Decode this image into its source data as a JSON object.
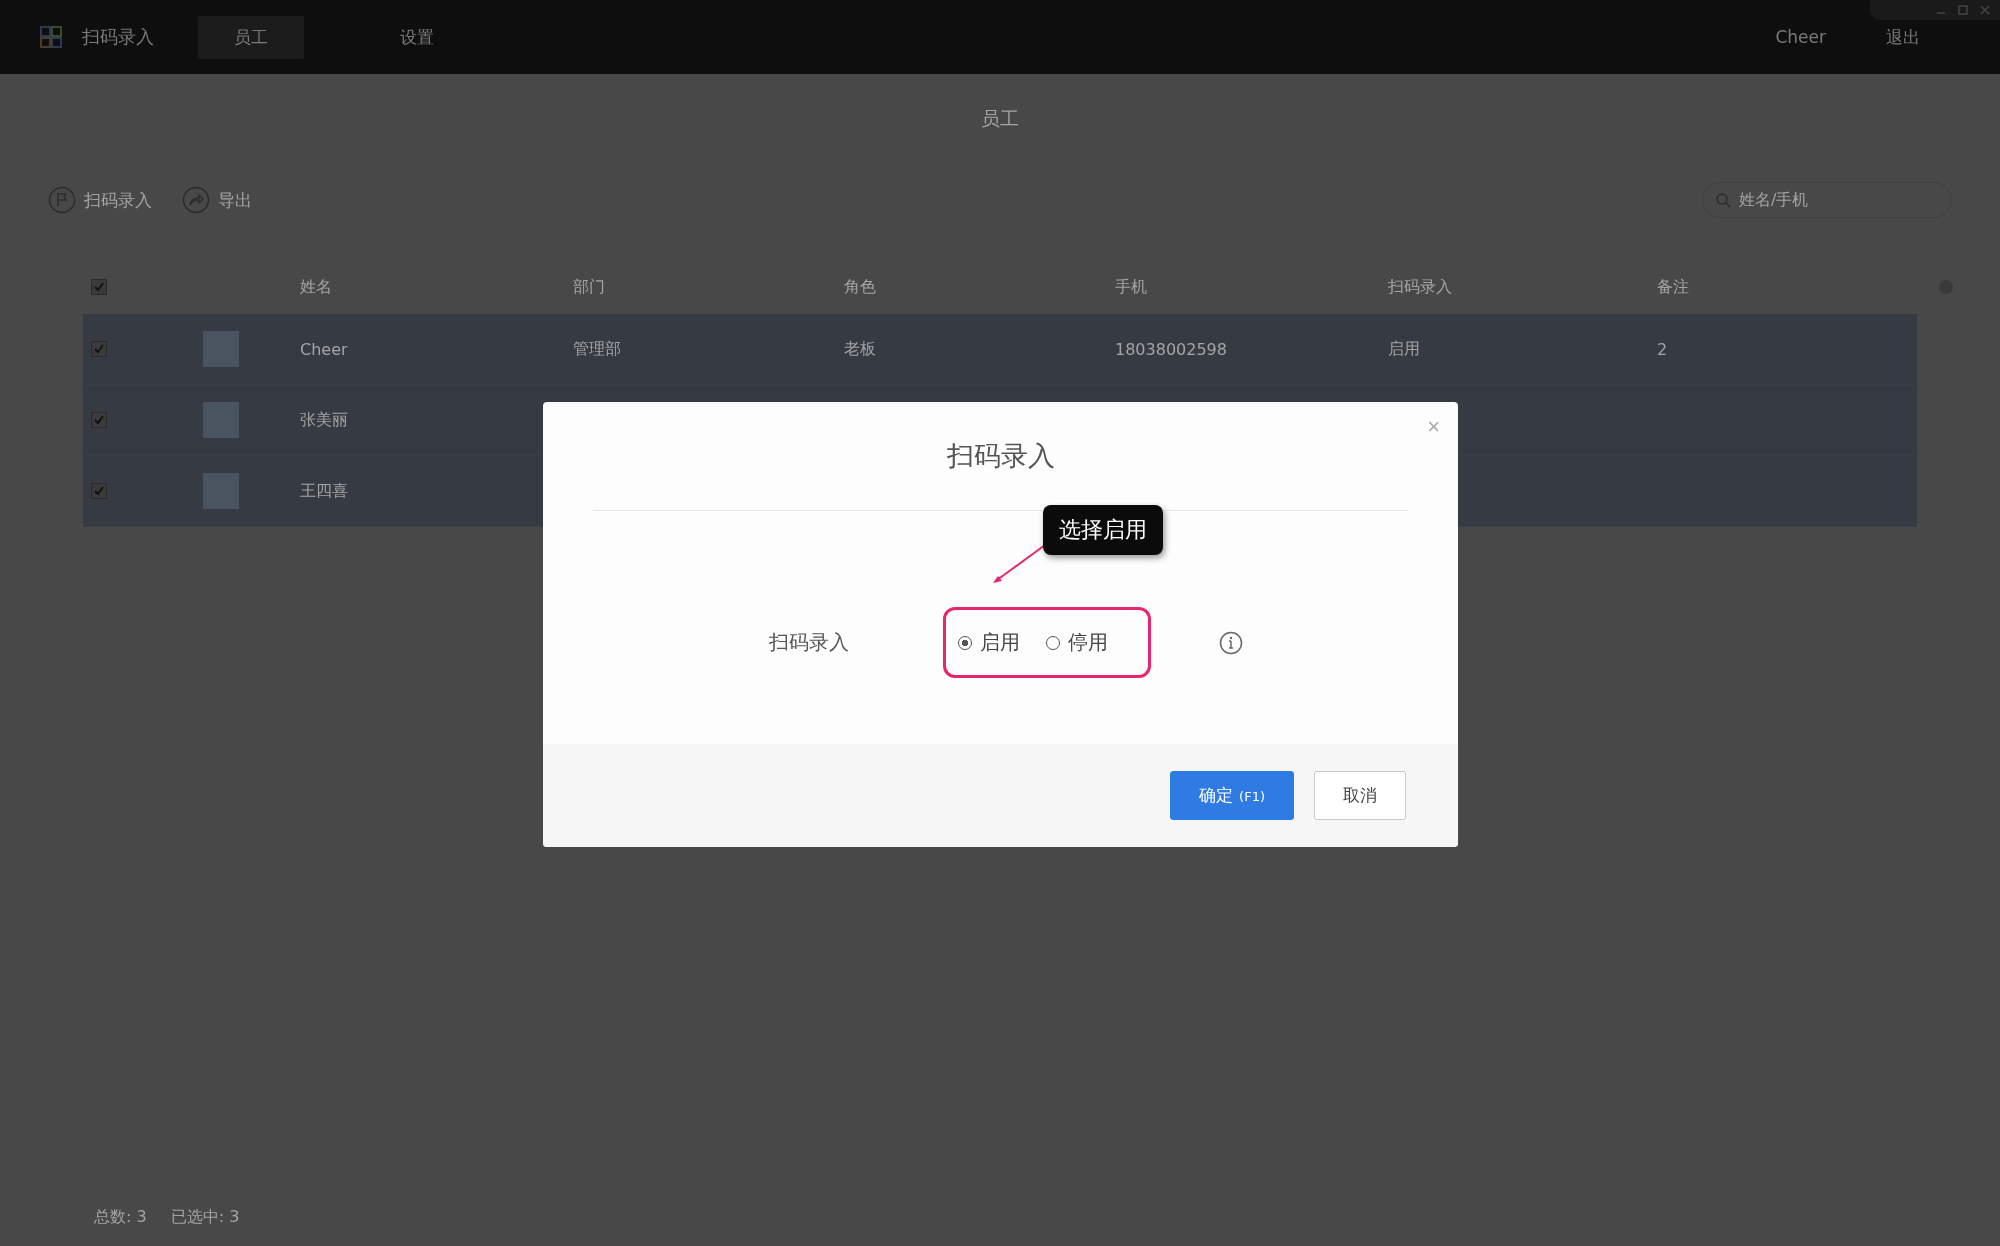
{
  "app": {
    "title": "扫码录入",
    "nav": [
      {
        "label": "员工",
        "selected": true
      },
      {
        "label": "设置",
        "selected": false
      }
    ],
    "user": "Cheer",
    "logout": "退出"
  },
  "page": {
    "title": "员工",
    "actions": [
      {
        "kind": "scan",
        "label": "扫码录入"
      },
      {
        "kind": "export",
        "label": "导出"
      }
    ],
    "search": {
      "placeholder": "姓名/手机"
    }
  },
  "table": {
    "all_checked": true,
    "columns": [
      "姓名",
      "部门",
      "角色",
      "手机",
      "扫码录入",
      "备注"
    ],
    "rows": [
      {
        "checked": true,
        "name": "Cheer",
        "department": "管理部",
        "role": "老板",
        "phone": "18038002598",
        "scan": "启用",
        "note": "2"
      },
      {
        "checked": true,
        "name": "张美丽"
      },
      {
        "checked": true,
        "name": "王四喜"
      }
    ]
  },
  "footer": {
    "total_label": "总数:",
    "total": "3",
    "selected_label": "已选中:",
    "selected": "3"
  },
  "dialog": {
    "title": "扫码录入",
    "close": "×",
    "field_label": "扫码录入",
    "options": [
      {
        "label": "启用",
        "selected": true
      },
      {
        "label": "停用",
        "selected": false
      }
    ],
    "annotation": "选择启用",
    "buttons": [
      {
        "kind": "primary",
        "label": "确定",
        "hint": "(F1)"
      },
      {
        "kind": "secondary",
        "label": "取消"
      }
    ]
  }
}
